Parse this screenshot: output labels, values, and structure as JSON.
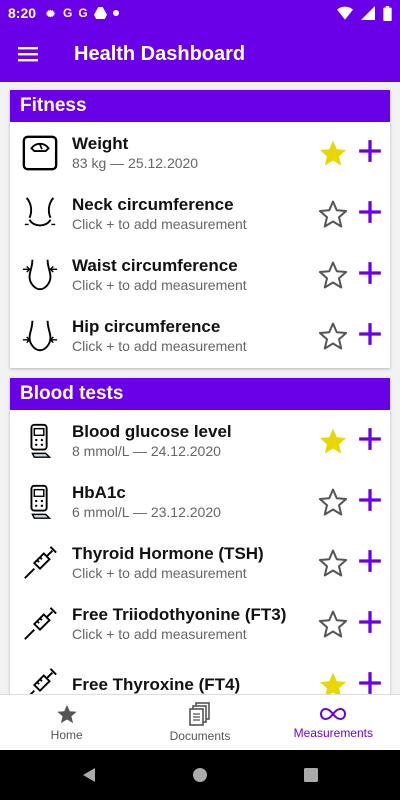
{
  "status": {
    "time": "8:20",
    "notif_letters": [
      "G",
      "G"
    ]
  },
  "appbar": {
    "title": "Health Dashboard"
  },
  "sections": [
    {
      "title": "Fitness",
      "items": [
        {
          "name": "Weight",
          "sub": "83 kg — 25.12.2020",
          "icon": "scale-icon",
          "favorite": true
        },
        {
          "name": "Neck circumference",
          "sub": "Click + to add measurement",
          "icon": "neck-icon",
          "favorite": false
        },
        {
          "name": "Waist circumference",
          "sub": "Click + to add measurement",
          "icon": "waist-icon",
          "favorite": false
        },
        {
          "name": "Hip circumference",
          "sub": "Click + to add measurement",
          "icon": "hip-icon",
          "favorite": false
        }
      ]
    },
    {
      "title": "Blood tests",
      "items": [
        {
          "name": "Blood glucose level",
          "sub": "8 mmol/L — 24.12.2020",
          "icon": "glucometer-icon",
          "favorite": true
        },
        {
          "name": "HbA1c",
          "sub": "6 mmol/L — 23.12.2020",
          "icon": "glucometer-icon",
          "favorite": false
        },
        {
          "name": "Thyroid Hormone (TSH)",
          "sub": "Click + to add measurement",
          "icon": "syringe-icon",
          "favorite": false
        },
        {
          "name": "Free Triiodothyonine (FT3)",
          "sub": "Click + to add measurement",
          "icon": "syringe-icon",
          "favorite": false
        },
        {
          "name": "Free Thyroxine (FT4)",
          "sub": "",
          "icon": "syringe-icon",
          "favorite": true
        }
      ]
    }
  ],
  "bottom_nav": [
    {
      "label": "Home",
      "icon": "star-icon",
      "active": false
    },
    {
      "label": "Documents",
      "icon": "documents-icon",
      "active": false
    },
    {
      "label": "Measurements",
      "icon": "infinity-icon",
      "active": true
    }
  ],
  "colors": {
    "primary": "#6a00e8",
    "star_filled": "#e6d800",
    "star_outline": "#555555"
  }
}
